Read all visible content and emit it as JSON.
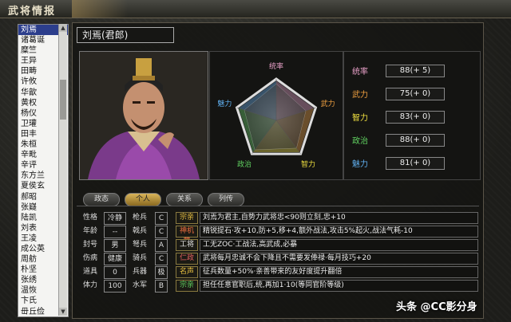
{
  "window_title": "武将情报",
  "officer_name": "刘焉(君郎)",
  "officer_list": [
    "刘焉",
    "诸葛诞",
    "糜竺",
    "王异",
    "田畴",
    "许攸",
    "华歆",
    "黄权",
    "杨仪",
    "卫瓘",
    "田丰",
    "朱桓",
    "辛毗",
    "辛评",
    "东方兰",
    "夏侯玄",
    "郝昭",
    "张嶷",
    "陆凯",
    "刘表",
    "王凌",
    "成公英",
    "周舫",
    "朴坚",
    "张绣",
    "温恢",
    "卞氏",
    "毌丘俭"
  ],
  "selected_index": 0,
  "radar": {
    "labels": {
      "tongshuai": "统率",
      "wuli": "武力",
      "zhili": "智力",
      "zhengzhi": "政治",
      "meili": "魅力"
    },
    "values": {
      "tongshuai": 88,
      "wuli": 75,
      "zhili": 83,
      "zhengzhi": 88,
      "meili": 81
    }
  },
  "stats": [
    {
      "label": "统率",
      "value": "88(+ 5)",
      "color": "#e8a0c8"
    },
    {
      "label": "武力",
      "value": "75(+ 0)",
      "color": "#f0a040"
    },
    {
      "label": "智力",
      "value": "83(+ 0)",
      "color": "#f0e040"
    },
    {
      "label": "政治",
      "value": "88(+ 0)",
      "color": "#60d060"
    },
    {
      "label": "魅力",
      "value": "81(+ 0)",
      "color": "#60b0f0"
    }
  ],
  "tabs": [
    "政态",
    "个人",
    "关系",
    "列传"
  ],
  "active_tab": 1,
  "attributes": [
    {
      "k": "性格",
      "v": "冷静",
      "k2": "枪兵",
      "v2": "C"
    },
    {
      "k": "年龄",
      "v": "--",
      "k2": "戟兵",
      "v2": "C"
    },
    {
      "k": "封号",
      "v": "男",
      "k2": "弩兵",
      "v2": "A"
    },
    {
      "k": "伤病",
      "v": "健康",
      "k2": "骑兵",
      "v2": "C"
    },
    {
      "k": "道具",
      "v": "0",
      "k2": "兵器",
      "v2": "极"
    },
    {
      "k": "体力",
      "v": "100",
      "k2": "水军",
      "v2": "B"
    }
  ],
  "skills": [
    {
      "tag": "宗亲",
      "tag_color": "#e8c040",
      "effect": "刘焉为君主,自势力武将忠<90则立刻,忠+10"
    },
    {
      "tag": "神机营",
      "tag_color": "#f07040",
      "effect": "精锐提石·攻+10,防+5,移+4,额外战法,攻击5%起火,战法气耗-10"
    },
    {
      "tag": "工将",
      "tag_color": "#e8e8e8",
      "effect": "工无ZOC·工战法,高武成,必暴"
    },
    {
      "tag": "仁政",
      "tag_color": "#e06060",
      "effect": "武将每月忠诚不会下降且不需要发俸禄·每月技巧+20"
    },
    {
      "tag": "名声",
      "tag_color": "#e8c040",
      "effect": "征兵数量+50%·亲善带来的友好度提升翻倍"
    },
    {
      "tag": "宗亲",
      "tag_color": "#60d060",
      "effect": "担任任意官职后,统,再加1·10(等同官阶等级)"
    }
  ],
  "watermark": "头条 @CC影分身"
}
